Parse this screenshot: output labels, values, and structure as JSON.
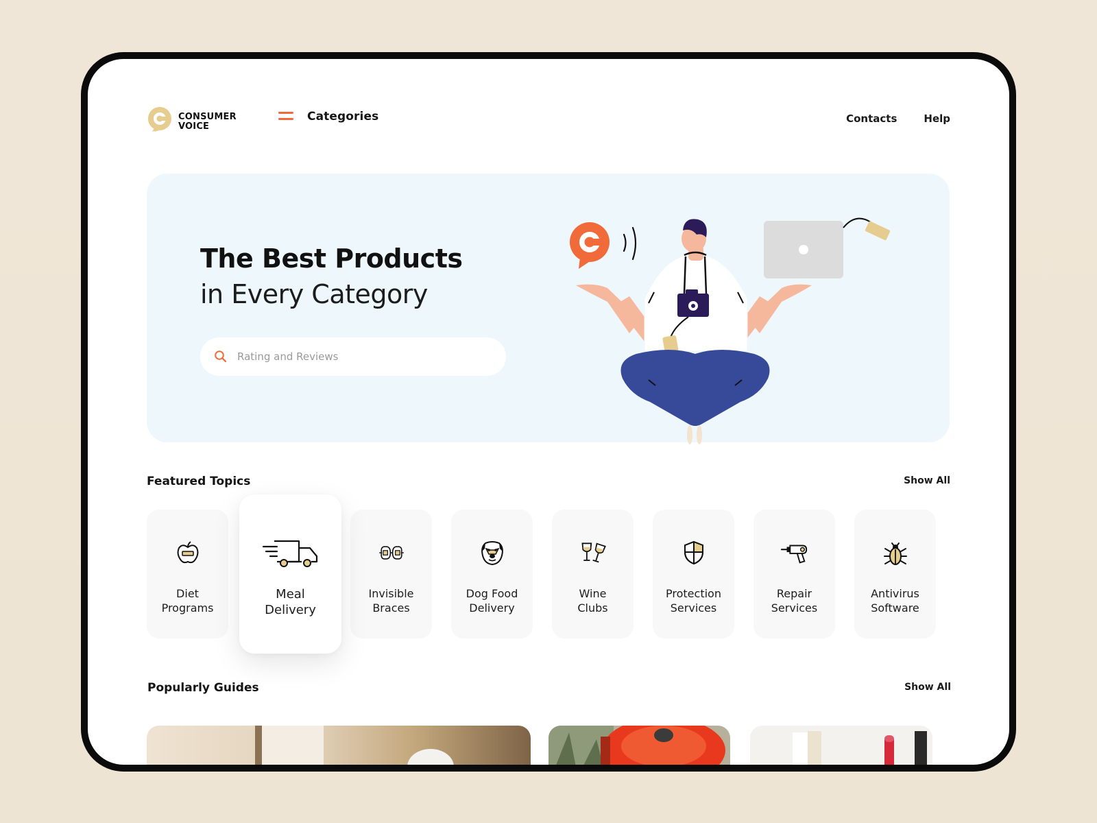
{
  "brand": {
    "name_line1": "CONSUMER",
    "name_line2": "VOICE",
    "logo_icon": "consumer-voice-logo-icon",
    "logo_color": "#e6cc8e"
  },
  "nav": {
    "menu_icon": "hamburger-icon",
    "categories_label": "Categories",
    "links": [
      "Contacts",
      "Help"
    ]
  },
  "hero": {
    "title": "The Best Products",
    "subtitle": "in Every Category",
    "search_placeholder": "Rating and Reviews",
    "search_value": "",
    "search_icon": "search-icon",
    "background": "#eef8fc",
    "illustration": "man-balancing-products-illustration"
  },
  "featured": {
    "title": "Featured Topics",
    "show_all": "Show All",
    "topics": [
      {
        "label": "Diet\nPrograms",
        "icon": "apple-icon"
      },
      {
        "label": "Meal\nDelivery",
        "icon": "delivery-truck-icon",
        "active": true
      },
      {
        "label": "Invisible\nBraces",
        "icon": "braces-icon"
      },
      {
        "label": "Dog Food\nDelivery",
        "icon": "dog-icon"
      },
      {
        "label": "Wine\nClubs",
        "icon": "wine-glasses-icon"
      },
      {
        "label": "Protection\nServices",
        "icon": "shield-icon"
      },
      {
        "label": "Repair\nServices",
        "icon": "drill-icon"
      },
      {
        "label": "Antivirus\nSoftware",
        "icon": "bug-icon"
      }
    ]
  },
  "guides": {
    "title": "Popularly Guides",
    "show_all": "Show All",
    "images": [
      "guide-image-interior",
      "guide-image-cookware",
      "guide-image-cosmetics"
    ]
  },
  "colors": {
    "accent": "#f06a3a",
    "gold": "#e6cc8e",
    "navy": "#2b1c59",
    "pants": "#364a99",
    "skin": "#f6b89c",
    "frame": "#0b0b0b",
    "page_bg": "#efe6d8"
  }
}
